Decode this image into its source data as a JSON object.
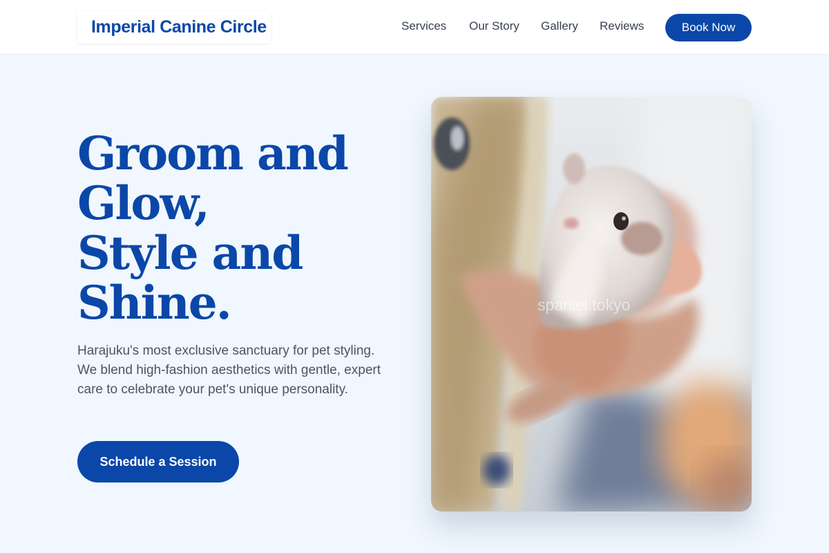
{
  "header": {
    "logo": "Imperial Canine Circle",
    "nav": [
      "Services",
      "Our Story",
      "Gallery",
      "Reviews"
    ],
    "cta": "Book Now"
  },
  "hero": {
    "title": "Groom and Glow,\nStyle and Shine.",
    "description": "Harajuku's most exclusive sanctuary for pet styling. We blend high-fashion aesthetics with gentle, expert care to celebrate your pet's unique personality.",
    "cta": "Schedule a Session"
  },
  "photo": {
    "subject": "hamster-in-hand",
    "watermark": "spaniel.tokyo"
  },
  "colors": {
    "brand": "#0b47a8",
    "background": "#f0f7fe",
    "text_muted": "#4b5563"
  }
}
